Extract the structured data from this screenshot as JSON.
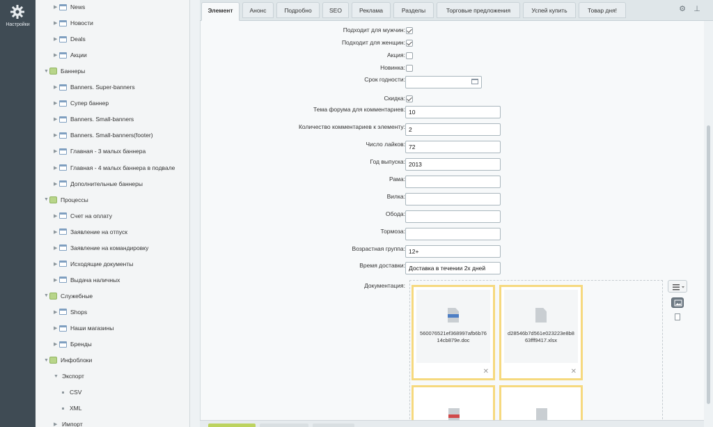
{
  "leftbar": {
    "settings_label": "Настройки",
    "icon": "gear-icon"
  },
  "tree": [
    {
      "label": "News",
      "level": 2,
      "kind": "folder"
    },
    {
      "label": "Новости",
      "level": 2,
      "kind": "folder"
    },
    {
      "label": "Deals",
      "level": 2,
      "kind": "folder"
    },
    {
      "label": "Акции",
      "level": 2,
      "kind": "folder"
    },
    {
      "label": "Баннеры",
      "level": 1,
      "kind": "group"
    },
    {
      "label": "Banners. Super-banners",
      "level": 2,
      "kind": "folder"
    },
    {
      "label": "Супер баннер",
      "level": 2,
      "kind": "folder"
    },
    {
      "label": "Banners. Small-banners",
      "level": 2,
      "kind": "folder"
    },
    {
      "label": "Banners. Small-banners(footer)",
      "level": 2,
      "kind": "folder"
    },
    {
      "label": "Главная - 3 малых баннера",
      "level": 2,
      "kind": "folder"
    },
    {
      "label": "Главная - 4 малых баннера в подвале",
      "level": 2,
      "kind": "folder"
    },
    {
      "label": "Дополнительные баннеры",
      "level": 2,
      "kind": "folder"
    },
    {
      "label": "Процессы",
      "level": 1,
      "kind": "group"
    },
    {
      "label": "Счет на оплату",
      "level": 2,
      "kind": "folder"
    },
    {
      "label": "Заявление на отпуск",
      "level": 2,
      "kind": "folder"
    },
    {
      "label": "Заявление на командировку",
      "level": 2,
      "kind": "folder"
    },
    {
      "label": "Исходящие документы",
      "level": 2,
      "kind": "folder"
    },
    {
      "label": "Выдача наличных",
      "level": 2,
      "kind": "folder"
    },
    {
      "label": "Служебные",
      "level": 1,
      "kind": "group"
    },
    {
      "label": "Shops",
      "level": 2,
      "kind": "folder"
    },
    {
      "label": "Наши магазины",
      "level": 2,
      "kind": "folder"
    },
    {
      "label": "Бренды",
      "level": 2,
      "kind": "folder"
    },
    {
      "label": "Инфоблоки",
      "level": 1,
      "kind": "group"
    },
    {
      "label": "Экспорт",
      "level": 2,
      "kind": "open"
    },
    {
      "label": "CSV",
      "level": 3,
      "kind": "leaf"
    },
    {
      "label": "XML",
      "level": 3,
      "kind": "leaf"
    },
    {
      "label": "Импорт",
      "level": 2,
      "kind": "closed"
    }
  ],
  "tabs": [
    {
      "label": "Элемент",
      "active": true
    },
    {
      "label": "Анонс"
    },
    {
      "label": "Подробно"
    },
    {
      "label": "SEO"
    },
    {
      "label": "Реклама"
    },
    {
      "label": "Разделы"
    },
    {
      "label": "Торговые предложения"
    },
    {
      "label": "Успей купить"
    },
    {
      "label": "Товар дня!"
    }
  ],
  "form": {
    "for_men": {
      "label": "Подходит для мужчин:",
      "checked": true
    },
    "for_women": {
      "label": "Подходит для женщин:",
      "checked": true
    },
    "promo": {
      "label": "Акция:",
      "checked": false
    },
    "new": {
      "label": "Новинка:",
      "checked": false
    },
    "expiry": {
      "label": "Срок годности:",
      "value": ""
    },
    "discount": {
      "label": "Скидка:",
      "checked": true
    },
    "forum_topic": {
      "label": "Тема форума для комментариев:",
      "value": "10"
    },
    "comment_count": {
      "label": "Количество комментариев к элементу:",
      "value": "2"
    },
    "likes": {
      "label": "Число лайков:",
      "value": "72"
    },
    "year": {
      "label": "Год выпуска:",
      "value": "2013"
    },
    "frame": {
      "label": "Рама:",
      "value": ""
    },
    "fork": {
      "label": "Вилка:",
      "value": ""
    },
    "rim": {
      "label": "Обода:",
      "value": ""
    },
    "brakes": {
      "label": "Тормоза:",
      "value": ""
    },
    "age_group": {
      "label": "Возрастная группа:",
      "value": "12+"
    },
    "delivery": {
      "label": "Время доставки:",
      "value": "Доставка в течении 2х дней"
    },
    "docs": {
      "label": "Документация:",
      "files": [
        {
          "name": "560076521ef368997afb6b7614cb879e.doc"
        },
        {
          "name": "d28546b7d561e023223e8b863fff9417.xlsx"
        }
      ]
    }
  }
}
